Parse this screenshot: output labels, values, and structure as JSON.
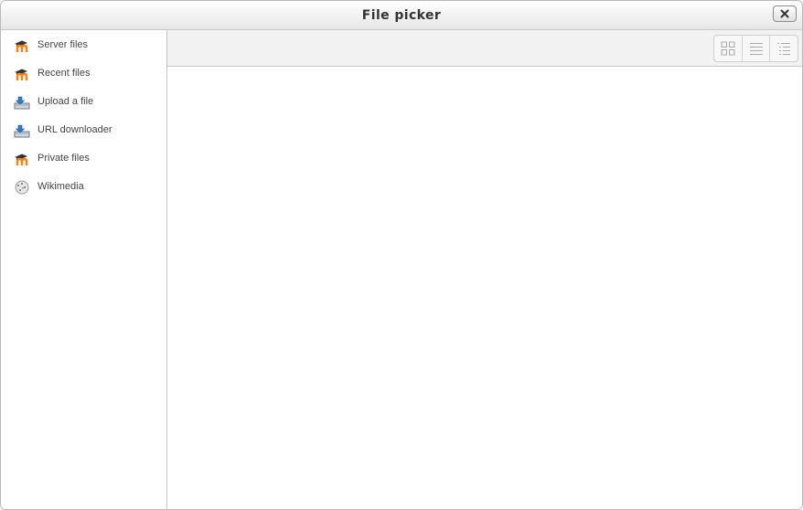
{
  "dialog": {
    "title": "File picker",
    "close_icon": "close-icon"
  },
  "sidebar": {
    "items": [
      {
        "label": "Server files",
        "icon": "moodle-icon"
      },
      {
        "label": "Recent files",
        "icon": "moodle-icon"
      },
      {
        "label": "Upload a file",
        "icon": "upload-icon"
      },
      {
        "label": "URL downloader",
        "icon": "download-icon"
      },
      {
        "label": "Private files",
        "icon": "moodle-icon"
      },
      {
        "label": "Wikimedia",
        "icon": "wikimedia-icon"
      }
    ]
  },
  "toolbar": {
    "view_buttons": [
      {
        "icon": "icons-view-icon"
      },
      {
        "icon": "list-view-icon"
      },
      {
        "icon": "tree-view-icon"
      }
    ]
  },
  "colors": {
    "moodle_orange": "#f98012",
    "moodle_dark": "#333333"
  }
}
